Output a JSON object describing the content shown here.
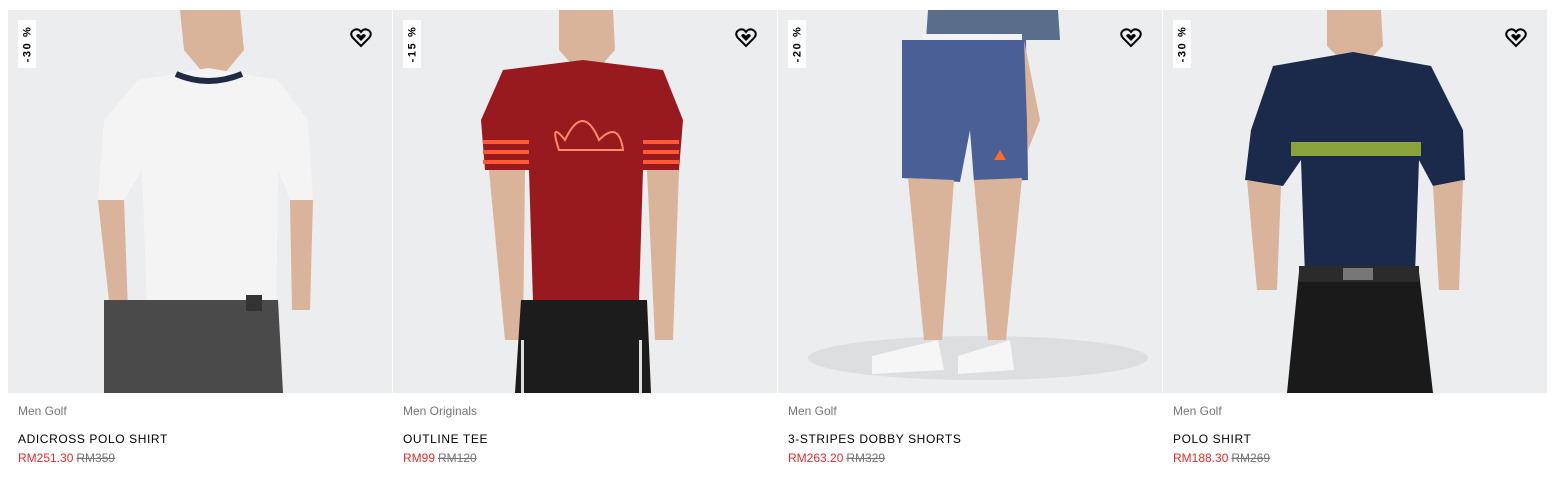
{
  "colors": {
    "sale": "#e32b2b",
    "muted": "#767677",
    "image_bg": "#ebedee"
  },
  "products": [
    {
      "badge": "-30 %",
      "category": "Men Golf",
      "name": "ADICROSS POLO SHIRT",
      "sale_price": "RM251.30",
      "original_price": "RM359",
      "wishlist_icon": "heart-icon"
    },
    {
      "badge": "-15 %",
      "category": "Men Originals",
      "name": "OUTLINE TEE",
      "sale_price": "RM99",
      "original_price": "RM120",
      "wishlist_icon": "heart-icon"
    },
    {
      "badge": "-20 %",
      "category": "Men Golf",
      "name": "3-STRIPES DOBBY SHORTS",
      "sale_price": "RM263.20",
      "original_price": "RM329",
      "wishlist_icon": "heart-icon"
    },
    {
      "badge": "-30 %",
      "category": "Men Golf",
      "name": "POLO SHIRT",
      "sale_price": "RM188.30",
      "original_price": "RM269",
      "wishlist_icon": "heart-icon"
    }
  ]
}
